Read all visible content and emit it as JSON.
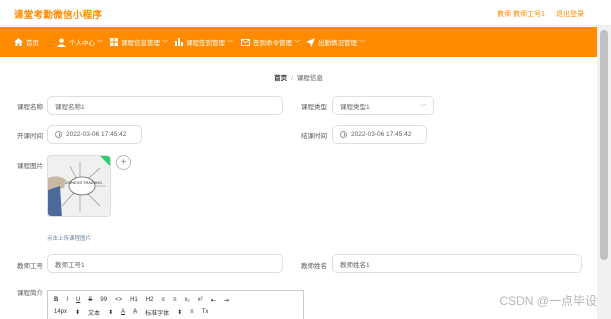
{
  "header": {
    "app_title": "课堂考勤微信小程序",
    "user_info": "教师 教师工号1",
    "logout_label": "退出登录"
  },
  "nav": {
    "items": [
      {
        "label": "首页",
        "icon": "home-icon"
      },
      {
        "label": "个人中心",
        "icon": "user-icon"
      },
      {
        "label": "课程信息管理",
        "icon": "grid-icon"
      },
      {
        "label": "课程签到管理",
        "icon": "bar-chart-icon"
      },
      {
        "label": "签到命令管理",
        "icon": "mail-icon"
      },
      {
        "label": "出勤情况管理",
        "icon": "send-icon"
      }
    ]
  },
  "breadcrumb": {
    "home": "首页",
    "separator": "/",
    "current": "课程信息"
  },
  "form": {
    "course_name": {
      "label": "课程名称",
      "value": "课程名称1"
    },
    "course_type": {
      "label": "课程类型",
      "value": "课程类型1"
    },
    "start_time": {
      "label": "开课时间",
      "value": "2022-03-06 17:45:42"
    },
    "end_time": {
      "label": "结课时间",
      "value": "2022-03-06 17:45:42"
    },
    "course_image": {
      "label": "课程图片",
      "hint": "点击上传课程图片",
      "image_text": "BUSINESS TRAINING"
    },
    "teacher_id": {
      "label": "教师工号",
      "value": "教师工号1"
    },
    "teacher_name": {
      "label": "教师姓名",
      "value": "教师姓名1"
    },
    "course_intro": {
      "label": "课程简介"
    }
  },
  "editor": {
    "row1": [
      "B",
      "I",
      "U",
      "S",
      "99",
      "<>",
      "H1",
      "H2",
      "≡",
      "≡",
      "x₂",
      "x²",
      "⇤",
      "⇥"
    ],
    "row2": [
      "14px",
      "文本",
      "A",
      "A",
      "标准字体",
      "≡",
      "Tx"
    ]
  },
  "watermark": "CSDN @一点毕设",
  "colors": {
    "accent": "#ff8c00",
    "nav_text": "#ffffff"
  }
}
